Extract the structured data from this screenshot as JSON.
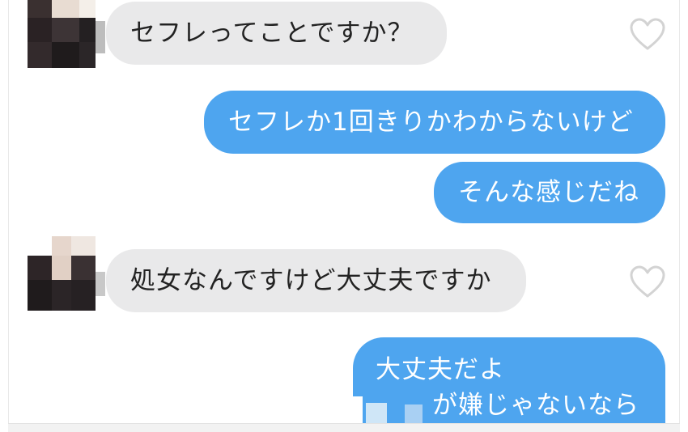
{
  "chat": {
    "messages": [
      {
        "from": "them",
        "text": "セフレってことですか？",
        "liked": false
      },
      {
        "from": "me",
        "text": "セフレか1回きりかわからないけど"
      },
      {
        "from": "me",
        "text": "そんな感じだね"
      },
      {
        "from": "them",
        "text": "処女なんですけど大丈夫ですか",
        "liked": false
      },
      {
        "from": "me",
        "lines": [
          "大丈夫だよ",
          "が嫌じゃないなら"
        ]
      }
    ]
  },
  "colors": {
    "outgoing_bubble": "#4ea5ef",
    "incoming_bubble": "#e9e9ea",
    "incoming_text": "#222222",
    "outgoing_text": "#ffffff",
    "heart_outline": "#d3d3d3"
  },
  "icons": {
    "like": "heart-outline-icon",
    "avatar": "pixelated-avatar"
  }
}
